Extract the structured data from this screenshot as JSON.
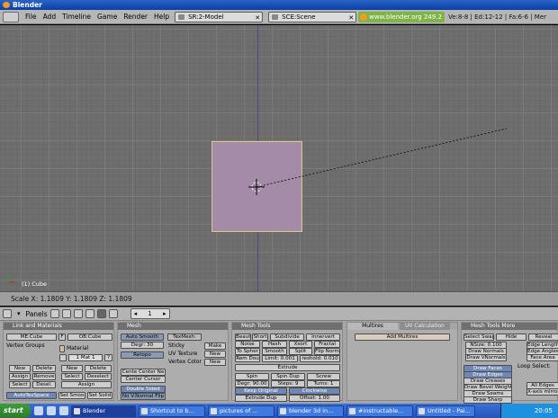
{
  "window": {
    "title": "Blender"
  },
  "header": {
    "menus": [
      "File",
      "Add",
      "Timeline",
      "Game",
      "Render",
      "Help"
    ],
    "screen_field": "SR:2-Model",
    "scene_field": "SCE:Scene",
    "url": "www.blender.org 249.2",
    "stats": "Ve:8-8 | Ed:12-12 | Fa:6-6 | Mer"
  },
  "viewport": {
    "object_name": "(1) Cube"
  },
  "status": {
    "scale_text": "Scale X: 1.1809   Y: 1.1809   Z: 1.1809"
  },
  "buttons_header": {
    "panels_label": "Panels",
    "frame": "1"
  },
  "link_panel": {
    "title": "Link and Materials",
    "me": "ME:Cube",
    "f": "F",
    "ob": "OB:Cube",
    "vertex_groups": "Vertex Groups",
    "material": "Material",
    "mat": "1 Mat 1",
    "q": "?",
    "new": "New",
    "delete": "Delete",
    "assign": "Assign",
    "remove": "Remove",
    "select": "Select",
    "desel": "Desel.",
    "new2": "New",
    "delete2": "Delete",
    "select2": "Select",
    "deselect2": "Deselect",
    "assign2": "Assign",
    "autotex": "AutoTexSpace",
    "set_smooth": "Set Smoo",
    "set_solid": "Set Solid"
  },
  "mesh_panel": {
    "title": "Mesh",
    "auto_smooth": "Auto Smooth",
    "degr": "Degr: 30",
    "retopo": "Retopo",
    "texmesh": "TexMesh:",
    "sticky": "Sticky",
    "make": "Make",
    "uv_texture": "UV Texture",
    "new_uv": "New",
    "vertex_color": "Vertex Color",
    "new_vc": "New",
    "cente_center": "Cente Center Ne",
    "center_cursor": "Center Cursor",
    "double_sided": "Double Sided",
    "no_vnormal": "No V.Normal Flip"
  },
  "tools_panel": {
    "title": "Mesh Tools",
    "r1": [
      "Beaut",
      "Short",
      "Subdivide",
      "Innervert"
    ],
    "r2": [
      "Noise",
      "Hash",
      "Xsort",
      "Fractal"
    ],
    "r3": [
      "To Spher",
      "Smooth",
      "Split",
      "Flip Norm"
    ],
    "r4": [
      "Rem Dou",
      "Limit: 0.001",
      "reshold: 0.010"
    ],
    "extrude": "Extrude",
    "r6": [
      "Spin",
      "Spin Dup",
      "Screw"
    ],
    "degr": "Degr: 90.00",
    "steps": "Steps: 9",
    "turns": "Turns: 1",
    "keep_original": "Keep Original",
    "clockwise": "Clockwise",
    "extrude_dup": "Extrude Dup",
    "offset": "Offset: 1.00"
  },
  "multires_panel": {
    "tab1": "Multires",
    "tab2": "UV Calculation",
    "add": "Add Multires"
  },
  "tools_more_panel": {
    "title": "Mesh Tools More",
    "select_swap": "Select Swap",
    "hide": "Hide",
    "reveal": "Reveal",
    "nsize": "NSize: 0.100",
    "draw_normals": "Draw Normals",
    "draw_vnormals": "Draw VNormals",
    "edge_length": "Edge Length",
    "edge_angles": "Edge Angles",
    "face_area": "Face Area",
    "draw_faces": "Draw Faces",
    "draw_edges": "Draw Edges",
    "draw_creases": "Draw Creases",
    "draw_bevel": "Draw Bevel Weight",
    "draw_seams": "Draw Seams",
    "draw_sharp": "Draw Sharp",
    "loop_select": "Loop Select:",
    "all_edges": "All Edges",
    "xaxis_mirror": "X-axis mirror"
  },
  "taskbar": {
    "start": "start",
    "tasks": [
      "Blender",
      "Shortcut to b...",
      "pictures of ...",
      "blender 3d in...",
      "#instructable...",
      "Untitled - Pai..."
    ],
    "clock": "20:05"
  }
}
